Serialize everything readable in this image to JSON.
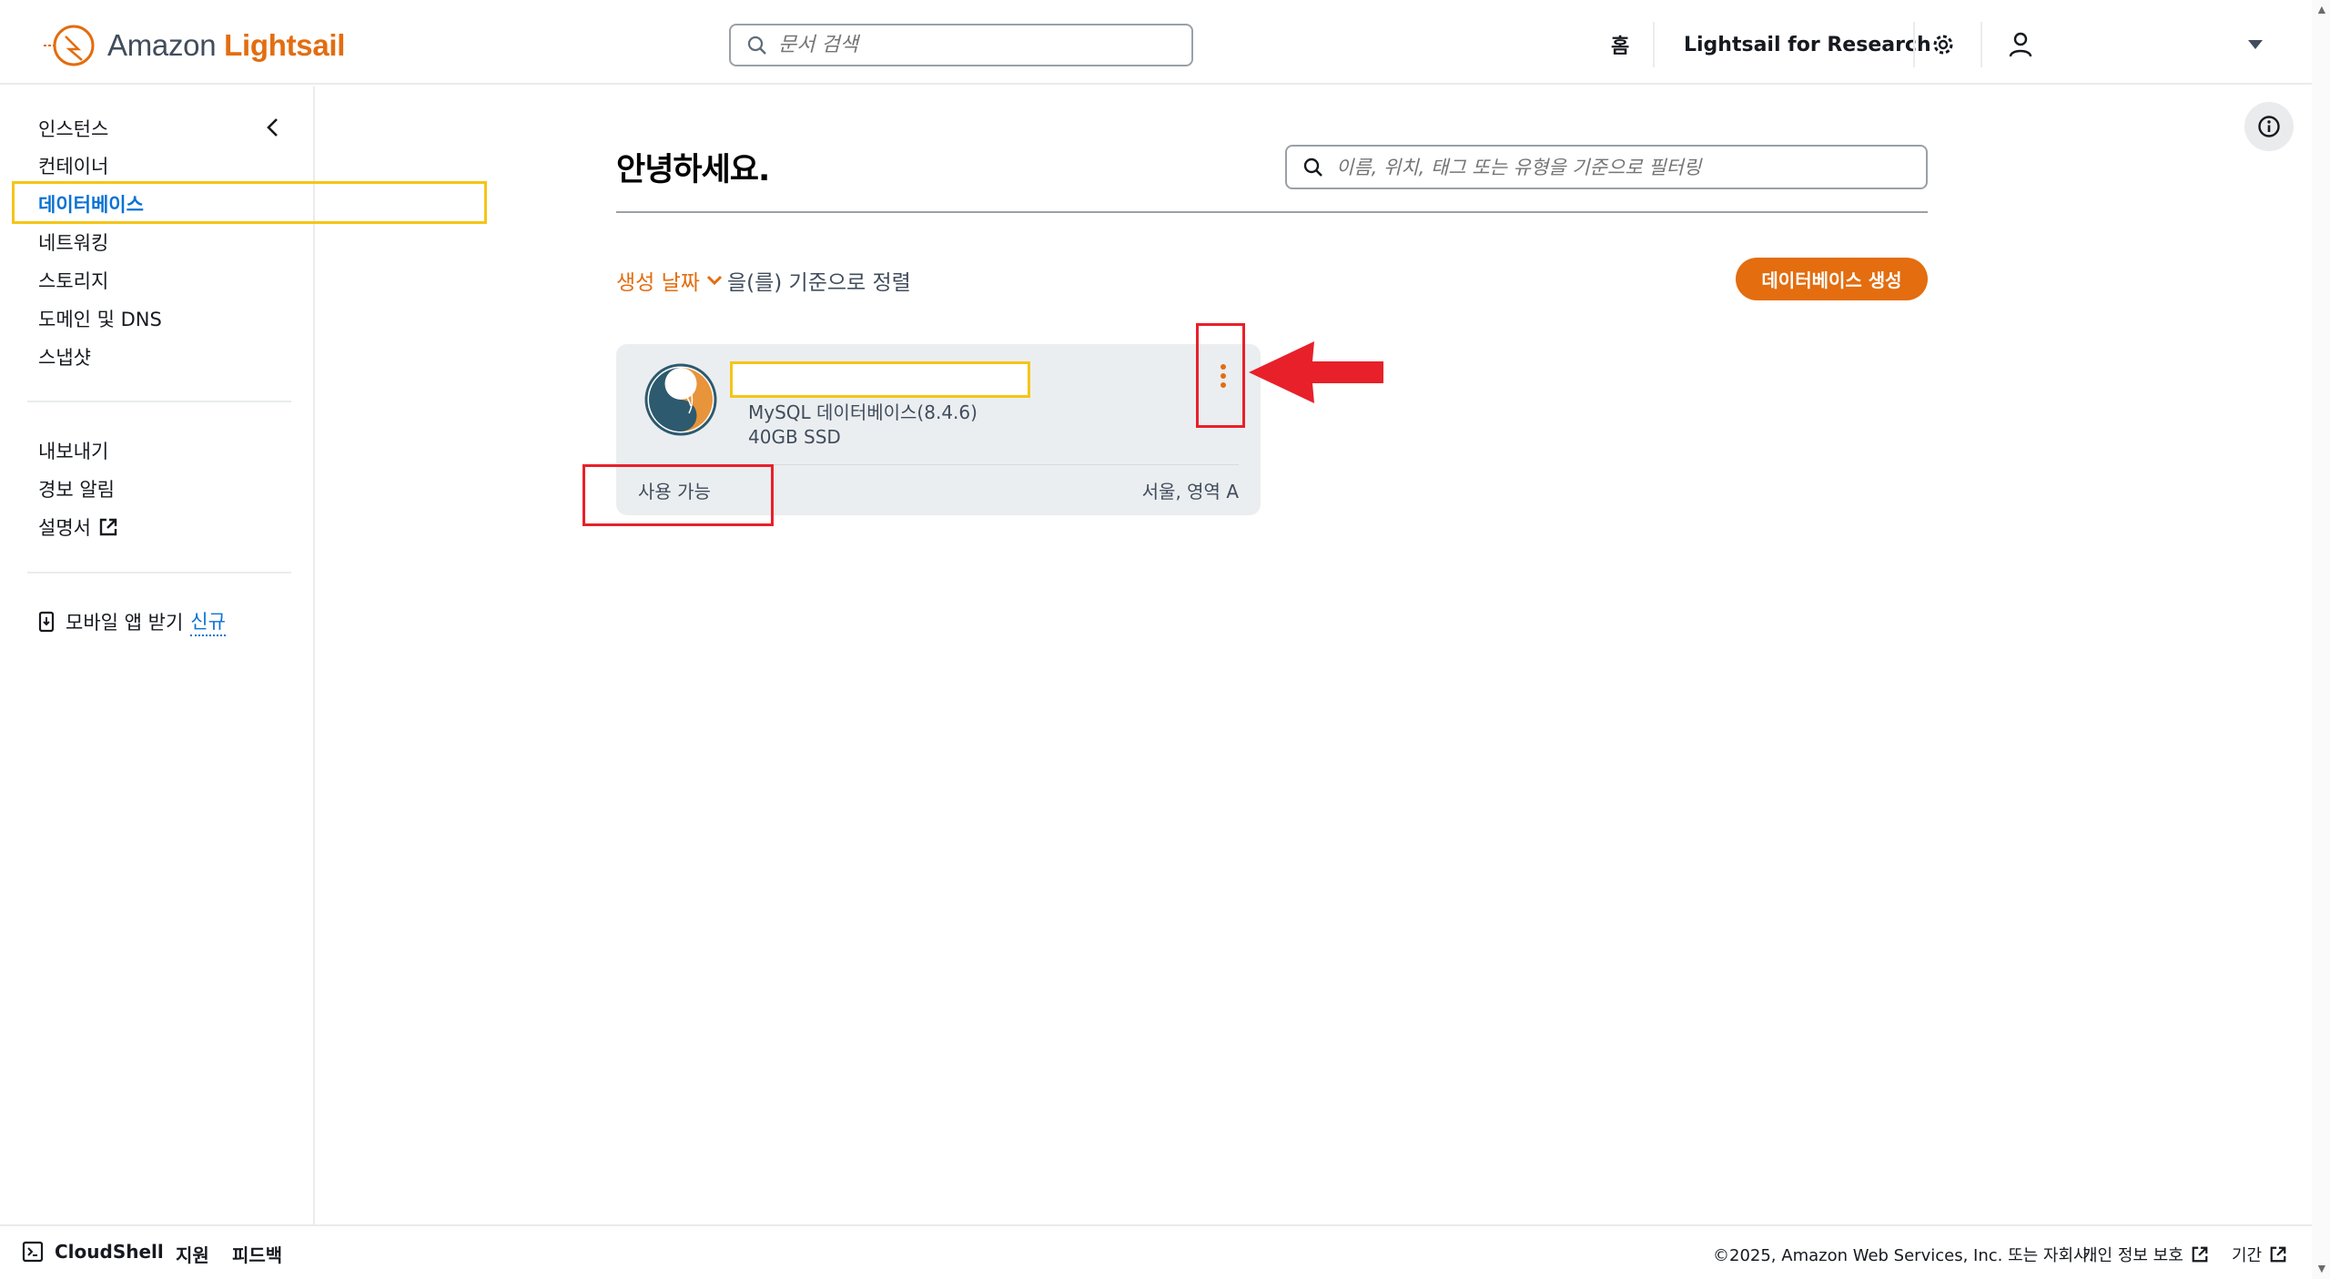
{
  "header": {
    "logo_prefix": "Amazon",
    "logo_brand": "Lightsail",
    "search_placeholder": "문서 검색",
    "home_label": "홈",
    "research_label": "Lightsail for Research"
  },
  "sidebar": {
    "items": [
      {
        "label": "인스턴스"
      },
      {
        "label": "컨테이너"
      },
      {
        "label": "데이터베이스"
      },
      {
        "label": "네트워킹"
      },
      {
        "label": "스토리지"
      },
      {
        "label": "도메인 및 DNS"
      },
      {
        "label": "스냅샷"
      }
    ],
    "secondary": [
      {
        "label": "내보내기"
      },
      {
        "label": "경보 알림"
      },
      {
        "label": "설명서"
      }
    ],
    "mobile_app_label": "모바일 앱 받기",
    "mobile_app_badge": "신규"
  },
  "main": {
    "greeting": "안녕하세요.",
    "filter_placeholder": "이름, 위치, 태그 또는 유형을 기준으로 필터링",
    "sort_key": "생성 날짜",
    "sort_suffix": "을(를) 기준으로 정렬",
    "create_button": "데이터베이스 생성"
  },
  "database_card": {
    "engine": "MySQL 데이터베이스(8.4.6)",
    "storage": "40GB SSD",
    "status": "사용 가능",
    "region": "서울, 영역 A"
  },
  "footer": {
    "cloudshell": "CloudShell",
    "support": "지원",
    "feedback": "피드백",
    "copyright": "©2025, Amazon Web Services, Inc. 또는 자회사.",
    "privacy": "개인 정보 보호",
    "terms": "기간"
  },
  "colors": {
    "accent": "#e36d0f",
    "link": "#0972d3",
    "annotation_red": "#e8202a",
    "annotation_yellow": "#f5c518"
  }
}
